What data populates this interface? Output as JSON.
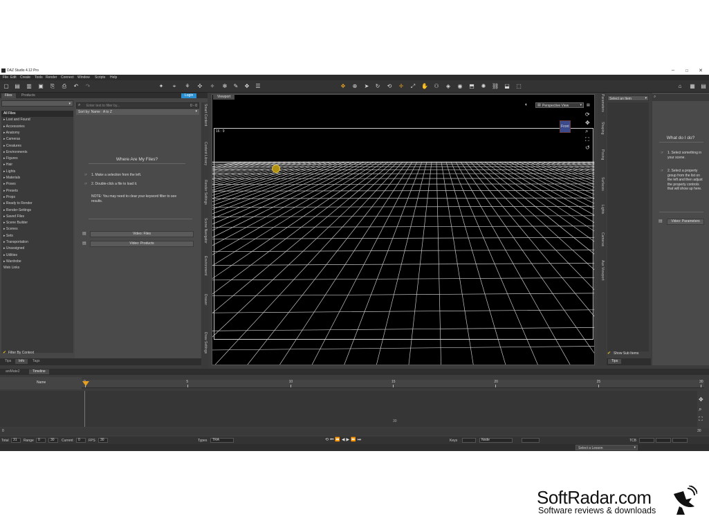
{
  "window": {
    "title": "DAZ Studio 4.12 Pro",
    "controls": [
      "–",
      "☐",
      "✕"
    ]
  },
  "menu": [
    "File",
    "Edit",
    "Create",
    "Tools",
    "Render",
    "Connect",
    "Window",
    "Scripts",
    "Help"
  ],
  "left_panel": {
    "tabs": [
      "Files",
      "Products"
    ],
    "login_label": "Login",
    "filter_label": "Filter By Context",
    "bottom_tabs": [
      "Tips",
      "Info",
      "Tags"
    ],
    "search_placeholder": "Enter text to filter by...",
    "sort_label": "Sort by: Name : A to Z",
    "page_indicator": "0 - 0",
    "categories": [
      "All Files",
      "▸ Lost and Found",
      "▸ Accessories",
      "▸ Anatomy",
      "▸ Cameras",
      "▸ Creatures",
      "▸ Environments",
      "▸ Figures",
      "▸ Hair",
      "▸ Lights",
      "▸ Materials",
      "▸ Poses",
      "▸ Presets",
      "▸ Props",
      "▸ Ready to Render",
      "▸ Render-Settings",
      "▸ Saved Files",
      "▸ Scene Builder",
      "▸ Scenes",
      "▸ Sets",
      "▸ Transportation",
      "▸ Unassigned",
      "▸ Utilities",
      "▸ Wardrobe",
      "Web Links"
    ],
    "help_title": "Where Are My Files?",
    "step1": "1. Make a selection from the left.",
    "step2": "2. Double-click a file to load it.",
    "note": "NOTE: You may need to clear your keyword filter to see results.",
    "video_files": "Video: Files",
    "video_products": "Video: Products"
  },
  "side_tabs": [
    "Smart Content",
    "Content Library",
    "Render Settings",
    "Scene Navigator",
    "Environment",
    "Drawer",
    "Draw Settings"
  ],
  "viewport": {
    "tab_label": "Viewport",
    "aspect": "16 : 9",
    "view_mode": "Perspective View",
    "cube_label": "Front"
  },
  "right_strip_tabs": [
    "Parameters",
    "Shaping",
    "Posing",
    "Surfaces",
    "Lights",
    "Cameras",
    "Aux Viewport"
  ],
  "parameters": {
    "select_label": "Select an Item",
    "show_sub_items": "Show Sub Items",
    "tips_tab": "Tips"
  },
  "help_pane": {
    "title": "What do I do?",
    "step1": "1. Select something in your scene.",
    "step2": "2. Select a property group from the list on the left and then adjust the property controls that will show up here.",
    "video": "Video: Parameters"
  },
  "timeline": {
    "tabs": [
      "aniMate2",
      "Timeline"
    ],
    "name_header": "Name",
    "ruler_ticks": [
      "0",
      "5",
      "10",
      "15",
      "20",
      "25",
      "30"
    ],
    "current_frame_marker": "30",
    "range_start": "0",
    "range_end": "30",
    "total_label": "Total",
    "total_value": "31",
    "range_label": "Range",
    "current_label": "Current",
    "current_value": "0",
    "fps_label": "FPS",
    "fps_value": "30",
    "types_label": "Types",
    "types_value": "TRA",
    "keys_label": "Keys",
    "node_value": "Node",
    "tcb_label": "TCB",
    "lesson_label": "Select a Lesson"
  },
  "watermark": {
    "title": "SoftRadar.com",
    "subtitle": "Software reviews & downloads"
  },
  "colors": {
    "accent_orange": "#e6a020",
    "login_blue": "#2a8fd0",
    "grid_line": "#c8c8c8"
  }
}
